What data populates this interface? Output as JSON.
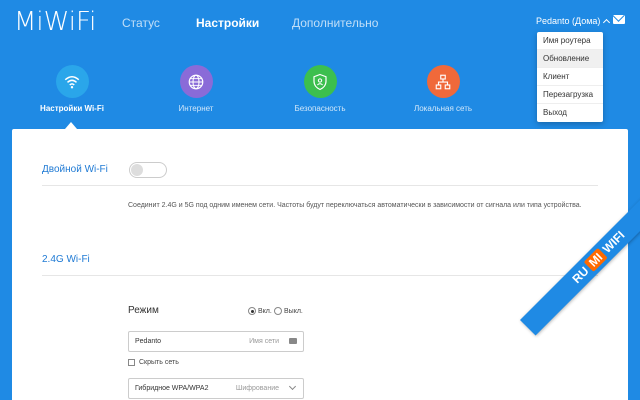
{
  "header": {
    "logo": "MiWiFi",
    "nav": [
      "Статус",
      "Настройки",
      "Дополнительно"
    ],
    "active_nav": 1,
    "user": "Pedanto (Дома)"
  },
  "dropdown": {
    "items": [
      "Имя роутера",
      "Обновление",
      "Клиент",
      "Перезагрузка",
      "Выход"
    ],
    "hover_index": 1
  },
  "tabs": [
    {
      "label": "Настройки Wi-Fi",
      "icon": "wifi-icon",
      "color": "#2aa6ea"
    },
    {
      "label": "Интернет",
      "icon": "globe-icon",
      "color": "#8a6bd8"
    },
    {
      "label": "Безопасность",
      "icon": "shield-icon",
      "color": "#3cbf4e"
    },
    {
      "label": "Локальная сеть",
      "icon": "network-icon",
      "color": "#f0693a"
    }
  ],
  "dual_wifi": {
    "title": "Двойной Wi-Fi",
    "enabled": false,
    "description": "Соединит 2.4G и 5G под одним именем сети. Частоты будут переключаться автоматически в зависимости от сигнала или типа устройства."
  },
  "wifi24": {
    "title": "2.4G Wi-Fi",
    "mode_label": "Режим",
    "on_label": "Вкл.",
    "off_label": "Выкл.",
    "ssid_value": "Pedanto",
    "ssid_placeholder": "Имя сети",
    "hide_label": "Скрыть сеть",
    "encryption_value": "Гибридное WPA/WPA2",
    "encryption_placeholder": "Шифрование"
  },
  "watermark": {
    "left": "RU",
    "middle": "MI",
    "right": "WIFI"
  }
}
